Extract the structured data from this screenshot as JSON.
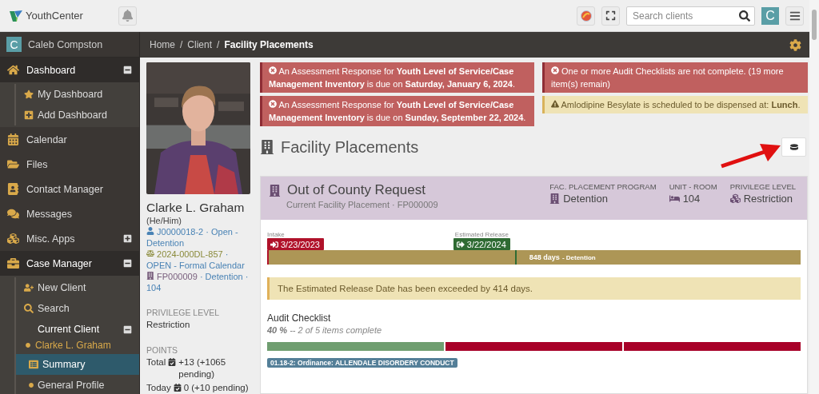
{
  "topbar": {
    "logo": "YouthCenter",
    "search": {
      "placeholder": "Search clients"
    },
    "avatar": "C"
  },
  "sidebar": {
    "user": {
      "initial": "C",
      "name": "Caleb Compston"
    },
    "items": [
      {
        "label": "Dashboard",
        "expanded": true,
        "selected": false,
        "children": [
          {
            "label": "My Dashboard",
            "selected": false
          },
          {
            "label": "Add Dashboard",
            "selected": false
          }
        ]
      },
      {
        "label": "Calendar",
        "selected": false
      },
      {
        "label": "Files",
        "selected": false
      },
      {
        "label": "Contact Manager",
        "selected": false
      },
      {
        "label": "Messages",
        "selected": false
      },
      {
        "label": "Misc. Apps",
        "expanded": false,
        "selected": false
      },
      {
        "label": "Case Manager",
        "expanded": true,
        "selected": false,
        "children": [
          {
            "label": "New Client",
            "selected": false
          },
          {
            "label": "Search",
            "selected": false
          },
          {
            "label": "Current Client",
            "expanded": true,
            "selected": false,
            "subtitle": "Clarke L. Graham",
            "children": [
              {
                "label": "Summary",
                "selected": true
              },
              {
                "label": "General Profile",
                "selected": false
              }
            ]
          }
        ]
      }
    ]
  },
  "breadcrumb": [
    {
      "label": "Home",
      "separator": "/"
    },
    {
      "label": "Client",
      "separator": "/"
    },
    {
      "label": "Facility Placements"
    }
  ],
  "profile": {
    "name": "Clarke L. Graham",
    "pronouns": "(He/Him)",
    "links": [
      {
        "code": "J0000018-2",
        "text": "· Open - Detention"
      },
      {
        "code": "2024-000DL-857",
        "text": "· OPEN - Formal Calendar"
      },
      {
        "code": "FP000009",
        "text": "· Detention · 104"
      }
    ],
    "privilege_label": "PRIVILEGE LEVEL",
    "privilege": "Restriction",
    "points_label": "POINTS",
    "points": [
      {
        "label": "Total",
        "value": "+13 (+1065 pending)"
      },
      {
        "label": "Today",
        "value": "0 (+10 pending)"
      }
    ]
  },
  "alerts_left": [
    {
      "kind": "danger",
      "text": "An Assessment Response for **Youth Level of Service/Case Management Inventory** is due on **Saturday, January 6, 2024**."
    },
    {
      "kind": "danger",
      "text": "An Assessment Response for **Youth Level of Service/Case Management Inventory** is due on **Sunday, September 22, 2024**."
    }
  ],
  "alerts_right": [
    {
      "kind": "danger",
      "text": "One or more Audit Checklists are not complete. (19 more item(s) remain)"
    },
    {
      "kind": "warning",
      "text": "Amlodipine Besylate is scheduled to be dispensed at: **Lunch**."
    }
  ],
  "heading": "Facility Placements",
  "placement": {
    "title": "Out of County Request",
    "subtitle": "Current Facility Placement · FP000009",
    "stats": [
      {
        "label": "FAC. PLACEMENT PROGRAM",
        "value": "Detention"
      },
      {
        "label": "UNIT - ROOM",
        "value": "104"
      },
      {
        "label": "PRIVILEGE LEVEL",
        "value": "Restriction"
      }
    ],
    "timeline": {
      "intake_label": "Intake",
      "intake_date": "3/23/2023",
      "release_label": "Estimated Release",
      "release_date": "3/22/2024",
      "level": 0.466,
      "duration": "848 days",
      "program": "- Detention"
    },
    "warning": "The Estimated Release Date has been exceeded by 414 days.",
    "audit": {
      "title": "Audit Checklist",
      "percent": "40 %",
      "detail": "-- 2 of 5 items complete",
      "segments": [
        {
          "complete": true
        },
        {
          "complete": false
        },
        {
          "complete": false
        }
      ],
      "tag": "01.18-2: Ordinance: ALLENDALE DISORDERY CONDUCT"
    }
  }
}
